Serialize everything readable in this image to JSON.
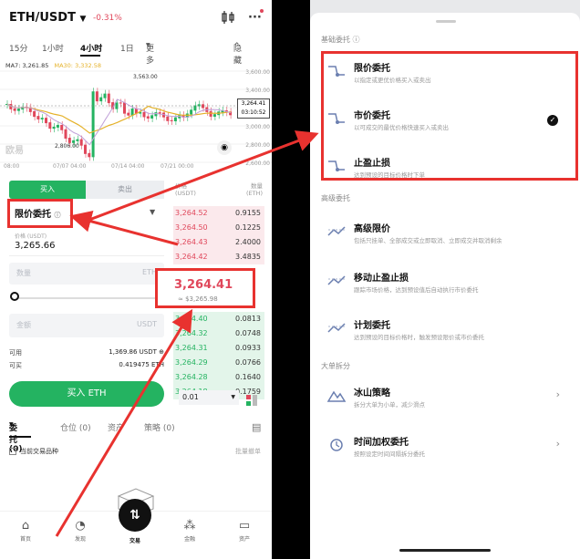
{
  "left": {
    "header": {
      "pair": "ETH/USDT",
      "change": "-0.31%"
    },
    "timeframes": [
      "15分",
      "1小时",
      "4小时",
      "1日",
      "更多"
    ],
    "hide_label": "隐藏",
    "ma": {
      "ma7": "MA7: 3,261.85",
      "ma30": "MA30: 3,332.58"
    },
    "chart": {
      "y_ticks": [
        "3,600.00",
        "3,400.00",
        "3,200.00",
        "3,000.00",
        "2,800.00",
        "2,600.00"
      ],
      "x_ticks": [
        "08:00",
        "07/07 04:00",
        "07/14 04:00",
        "07/21 00:00"
      ],
      "high_label": "3,563.00",
      "low_label": "2,806.00",
      "cur_price": "3,264.41",
      "countdown": "03:10:52",
      "watermark": "欧易"
    },
    "order": {
      "buy_tab": "买入",
      "sell_tab": "卖出",
      "order_type": "限价委托",
      "price_label": "价格 (USDT)",
      "price_value": "3,265.66",
      "qty_placeholder": "数量",
      "qty_unit": "ETH",
      "amount_placeholder": "金额",
      "amount_unit": "USDT",
      "available_label": "可用",
      "available_value": "1,369.86 USDT",
      "can_buy_label": "可买",
      "can_buy_value": "0.419475 ETH",
      "buy_button": "买入 ETH"
    },
    "orderbook": {
      "price_head": "价格\n(USDT)",
      "qty_head": "数量\n(ETH)",
      "asks": [
        {
          "p": "3,264.52",
          "q": "0.9155"
        },
        {
          "p": "3,264.50",
          "q": "0.1225"
        },
        {
          "p": "3,264.43",
          "q": "2.4000"
        },
        {
          "p": "3,264.42",
          "q": "3.4835"
        }
      ],
      "mid_price": "3,264.41",
      "mid_sub": "≈ $3,265.98",
      "bids": [
        {
          "p": "3,264.40",
          "q": "0.0813"
        },
        {
          "p": "3,264.32",
          "q": "0.0748"
        },
        {
          "p": "3,264.31",
          "q": "0.0933"
        },
        {
          "p": "3,264.29",
          "q": "0.0766"
        },
        {
          "p": "3,264.28",
          "q": "0.1640"
        },
        {
          "p": "3,264.18",
          "q": "0.1759"
        }
      ],
      "precision": "0.01"
    },
    "bottom_tabs": [
      "委托 (0)",
      "仓位 (0)",
      "资产",
      "策略 (0)"
    ],
    "current_only": "当前交易品种",
    "bulk": "批量撤单",
    "nav": [
      "首页",
      "发现",
      "交易",
      "金融",
      "资产"
    ]
  },
  "right": {
    "basic_title": "基础委托",
    "basic": [
      {
        "title": "限价委托",
        "desc": "以指定或更优价格买入或卖出"
      },
      {
        "title": "市价委托",
        "desc": "以可成交的最优价格快速买入或卖出"
      },
      {
        "title": "止盈止损",
        "desc": "达到预设的目标价格时下单"
      }
    ],
    "advanced_title": "高级委托",
    "advanced": [
      {
        "title": "高级限价",
        "desc": "包括只挂单、全部成交或立即取消、立即成交并取消剩余"
      },
      {
        "title": "移动止盈止损",
        "desc": "跟踪市场价格，达到预设值后自动执行市价委托"
      },
      {
        "title": "计划委托",
        "desc": "达到预设的目标价格时，触发预设限价或市价委托"
      }
    ],
    "split_title": "大单拆分",
    "split": [
      {
        "title": "冰山策略",
        "desc": "拆分大单为小单，减少滑点"
      },
      {
        "title": "时间加权委托",
        "desc": "按照设定时间间隔拆分委托"
      }
    ]
  },
  "colors": {
    "buy": "#24b361",
    "sell": "#e0475b",
    "highlight": "#e8322f"
  }
}
